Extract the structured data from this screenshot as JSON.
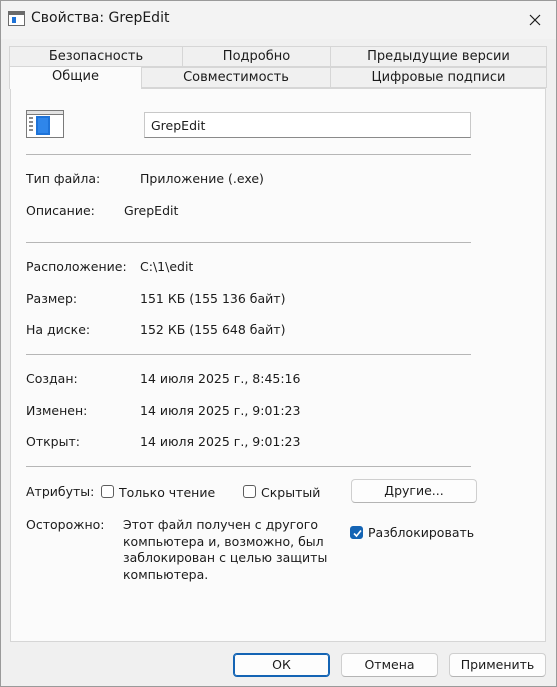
{
  "window": {
    "title": "Свойства: GrepEdit"
  },
  "tabs": {
    "row1": [
      "Безопасность",
      "Подробно",
      "Предыдущие версии"
    ],
    "row2": [
      "Общие",
      "Совместимость",
      "Цифровые подписи"
    ],
    "active": "Общие"
  },
  "general": {
    "file_name": "GrepEdit",
    "file_type_label": "Тип файла:",
    "file_type": "Приложение (.exe)",
    "description_label": "Описание:",
    "description": "GrepEdit",
    "location_label": "Расположение:",
    "location": "C:\\1\\edit",
    "size_label": "Размер:",
    "size": "151 КБ (155 136 байт)",
    "disk_size_label": "На диске:",
    "disk_size": "152 КБ (155 648 байт)",
    "created_label": "Создан:",
    "created": "14 июля 2025 г., 8:45:16",
    "modified_label": "Изменен:",
    "modified": "14 июля 2025 г., 9:01:23",
    "accessed_label": "Открыт:",
    "accessed": "14 июля 2025 г., 9:01:23",
    "attributes_label": "Атрибуты:",
    "readonly_label": "Только чтение",
    "readonly_checked": false,
    "hidden_label": "Скрытый",
    "hidden_checked": false,
    "other_button": "Другие...",
    "caution_label": "Осторожно:",
    "caution_text": "Этот файл получен с другого компьютера и, возможно, был заблокирован с целью защиты компьютера.",
    "unblock_label": "Разблокировать",
    "unblock_checked": true
  },
  "footer": {
    "ok": "ОК",
    "cancel": "Отмена",
    "apply": "Применить"
  },
  "colors": {
    "accent": "#1464b4",
    "icon_blue": "#1e73d8"
  }
}
